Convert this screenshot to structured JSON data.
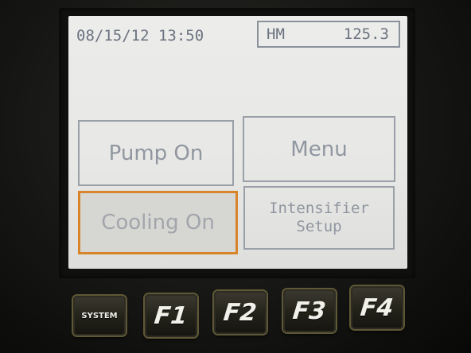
{
  "status_bar": {
    "datetime": "08/15/12 13:50",
    "mode_label": "HM",
    "mode_value": "125.3"
  },
  "buttons": {
    "pump": "Pump On",
    "menu": "Menu",
    "cooling": "Cooling On",
    "intensifier_line1": "Intensifier",
    "intensifier_line2": "Setup"
  },
  "function_keys": [
    "SYSTEM",
    "F1",
    "F2",
    "F3",
    "F4"
  ],
  "colors": {
    "screen_background": "#e9e9e7",
    "selected_outline": "#d8842a",
    "key_accent": "#5e5836"
  }
}
